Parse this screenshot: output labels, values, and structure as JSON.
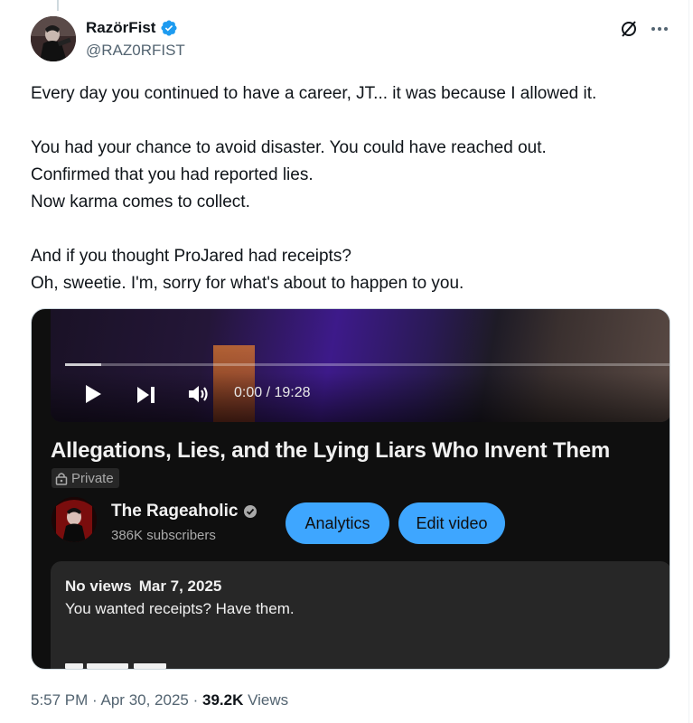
{
  "author": {
    "name": "RazörFist",
    "handle": "@RAZ0RFIST"
  },
  "icons": {
    "verified": "verified-badge-icon",
    "grok": "grok-icon",
    "more": "more-icon"
  },
  "colors": {
    "verified_blue": "#1d9bf0",
    "text_primary": "#0f1419",
    "text_secondary": "#536471",
    "yt_button": "#3ea6ff"
  },
  "tweet": {
    "lines": [
      "Every day you continued to have a career, JT... it was because I allowed it.",
      "",
      "You had your chance to avoid disaster. You could have reached out.",
      "Confirmed that you had reported lies.",
      "Now karma comes to collect.",
      "",
      "And if you thought ProJared had receipts?",
      "Oh, sweetie. I'm, sorry for what's about to happen to you."
    ]
  },
  "media": {
    "player": {
      "time": "0:00 / 19:28",
      "progress": 0.06
    },
    "video_title": "Allegations, Lies, and the Lying Liars Who Invent Them",
    "privacy": "Private",
    "channel": {
      "name": "The Rageaholic",
      "subscribers": "386K subscribers"
    },
    "buttons": {
      "analytics": "Analytics",
      "edit": "Edit video"
    },
    "description": {
      "views": "No views",
      "date": "Mar 7, 2025",
      "text": "You wanted receipts? Have them."
    }
  },
  "meta": {
    "time": "5:57 PM",
    "separator": "·",
    "date": "Apr 30, 2025",
    "views_count": "39.2K",
    "views_label": "Views"
  }
}
